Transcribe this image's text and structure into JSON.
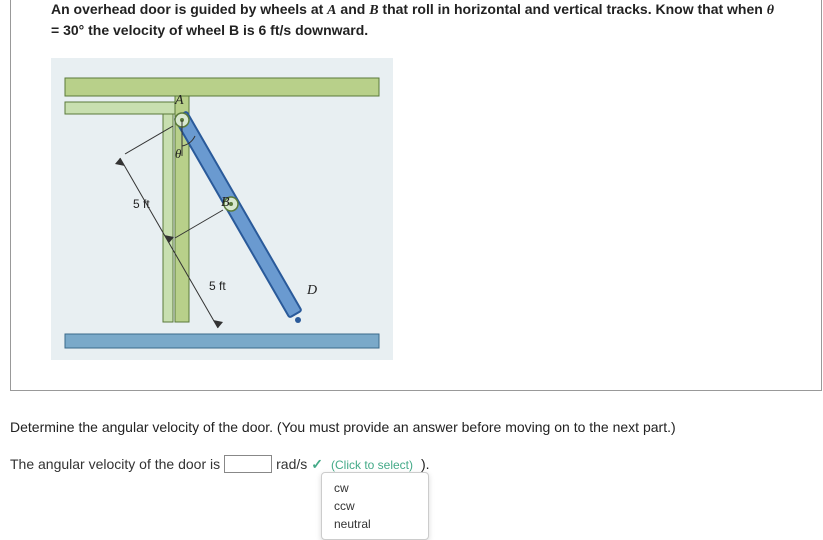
{
  "problem": {
    "text_before": "An overhead door is guided by wheels at ",
    "A": "A",
    "text_mid1": " and ",
    "B": "B",
    "text_mid2": " that roll in horizontal and vertical tracks. Know that when ",
    "theta": "θ",
    "eq": " = 30° the velocity of wheel B is 6 ft/s downward."
  },
  "figure": {
    "label_A": "A",
    "label_B": "B",
    "label_D": "D",
    "label_theta": "θ",
    "dim1": "5 ft",
    "dim2": "5 ft"
  },
  "question": "Determine the angular velocity of the door. (You must provide an answer before moving on to the next part.)",
  "answer": {
    "prefix": "The angular velocity of the door is",
    "unit": "rad/s",
    "dropdown_placeholder": "(Click to select)",
    "options": [
      "cw",
      "ccw",
      "neutral"
    ],
    "close_paren": ")."
  }
}
